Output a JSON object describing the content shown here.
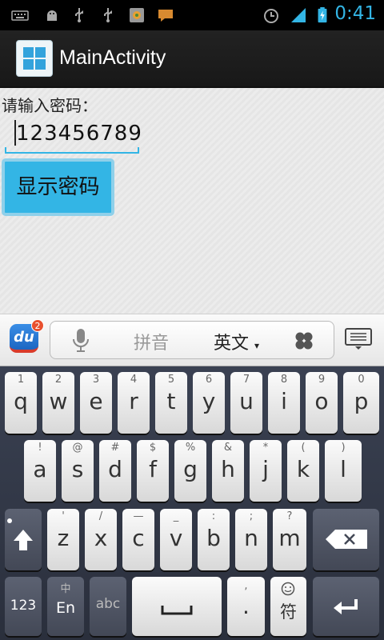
{
  "status_bar": {
    "clock": "0:41",
    "icons": [
      "keyboard-icon",
      "android-debug-icon",
      "usb-icon",
      "usb-icon",
      "app-icon",
      "chat-icon",
      "alarm-icon",
      "signal-icon",
      "battery-icon"
    ]
  },
  "action_bar": {
    "title": "MainActivity"
  },
  "content": {
    "prompt_label": "请输入密码：",
    "password_value": "123456789",
    "show_button_label": "显示密码"
  },
  "ime_bar": {
    "logo_text": "du",
    "badge_count": "2",
    "pinyin_label": "拼音",
    "english_label": "英文",
    "accent_color": "#33b5e5"
  },
  "keyboard": {
    "row1": [
      {
        "hint": "1",
        "main": "q"
      },
      {
        "hint": "2",
        "main": "w"
      },
      {
        "hint": "3",
        "main": "e"
      },
      {
        "hint": "4",
        "main": "r"
      },
      {
        "hint": "5",
        "main": "t"
      },
      {
        "hint": "6",
        "main": "y"
      },
      {
        "hint": "7",
        "main": "u"
      },
      {
        "hint": "8",
        "main": "i"
      },
      {
        "hint": "9",
        "main": "o"
      },
      {
        "hint": "0",
        "main": "p"
      }
    ],
    "row2": [
      {
        "hint": "!",
        "main": "a"
      },
      {
        "hint": "@",
        "main": "s"
      },
      {
        "hint": "#",
        "main": "d"
      },
      {
        "hint": "$",
        "main": "f"
      },
      {
        "hint": "%",
        "main": "g"
      },
      {
        "hint": "&",
        "main": "h"
      },
      {
        "hint": "*",
        "main": "j"
      },
      {
        "hint": "(",
        "main": "k"
      },
      {
        "hint": ")",
        "main": "l"
      }
    ],
    "row3": [
      {
        "hint": "'",
        "main": "z"
      },
      {
        "hint": "/",
        "main": "x"
      },
      {
        "hint": "—",
        "main": "c"
      },
      {
        "hint": "_",
        "main": "v"
      },
      {
        "hint": ":",
        "main": "b"
      },
      {
        "hint": ";",
        "main": "n"
      },
      {
        "hint": "?",
        "main": "m"
      }
    ],
    "num_key": "123",
    "lang_key_hint": "中",
    "lang_key": "En",
    "abc_key": "abc",
    "period_hint": ",",
    "period_key": ".",
    "symbol_key": "符"
  }
}
